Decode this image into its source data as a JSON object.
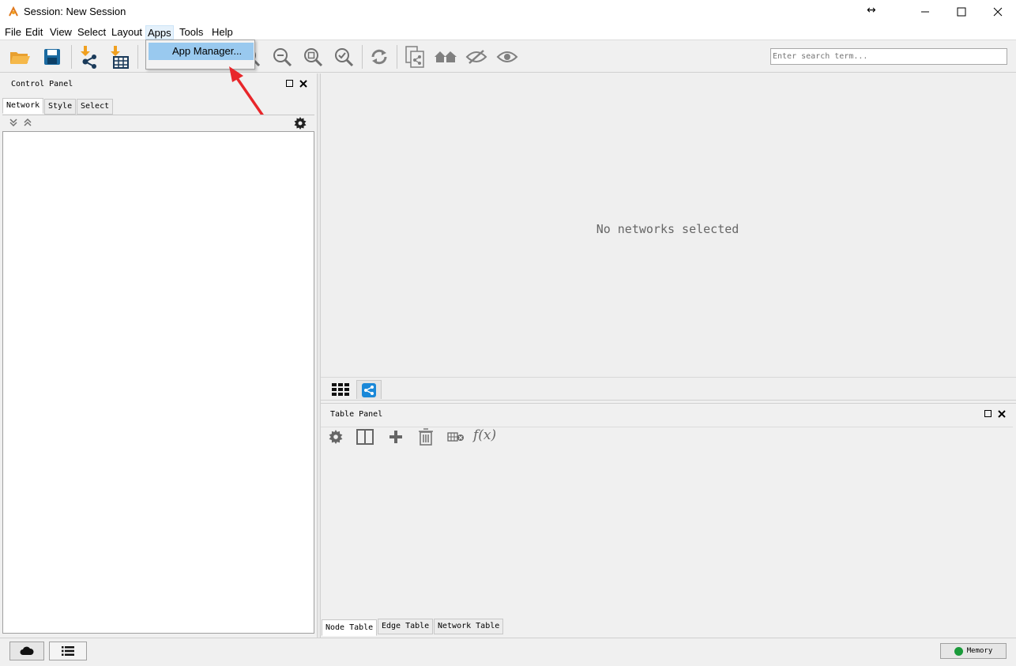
{
  "window": {
    "title": "Session: New Session",
    "resize_glyph": "↔"
  },
  "menubar": {
    "items": [
      "File",
      "Edit",
      "View",
      "Select",
      "Layout",
      "Apps",
      "Tools",
      "Help"
    ],
    "active": "Apps"
  },
  "apps_menu": {
    "items": [
      "App Manager..."
    ]
  },
  "toolbar": {
    "icons": [
      "open-folder-icon",
      "save-icon",
      "import-network-icon",
      "import-table-icon",
      "zoom-in-icon",
      "zoom-out-icon",
      "zoom-fit-icon",
      "zoom-selected-icon",
      "refresh-icon",
      "clone-network-icon",
      "home-icon",
      "hide-icon",
      "show-icon"
    ]
  },
  "search": {
    "placeholder": "Enter search term..."
  },
  "control_panel": {
    "title": "Control Panel",
    "tabs": [
      "Network",
      "Style",
      "Select"
    ],
    "selected_tab": "Network"
  },
  "network_view": {
    "empty_message": "No networks selected"
  },
  "table_panel": {
    "title": "Table Panel",
    "tabs": [
      "Node Table",
      "Edge Table",
      "Network Table"
    ],
    "selected_tab": "Node Table"
  },
  "status": {
    "memory_label": "Memory",
    "memory_color": "#1a9a3a"
  },
  "colors": {
    "accent": "#0078d7",
    "import_arrow": "#f0a020",
    "annotation_arrow": "#e8262a"
  }
}
